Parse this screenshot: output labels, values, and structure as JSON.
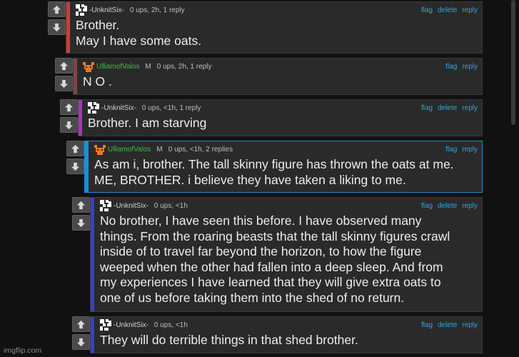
{
  "colors": {
    "background": "#111111",
    "panel": "#2a2a2a",
    "link": "#2aa7e0",
    "green_user": "#3fb950",
    "highlight_border": "#1a8fd6",
    "depth_stripes": [
      "#d33a3a",
      "#7a4a44",
      "#b22fc1",
      "#1a8fd6",
      "#3b3ccf",
      "#3b3ccf"
    ]
  },
  "icons": {
    "upvote": "up-arrow-icon",
    "downvote": "down-arrow-icon",
    "avatar_unknit": "pixel-avatar-icon",
    "avatar_ulliam": "orange-face-avatar-icon"
  },
  "comments": [
    {
      "username": "-UnknitSix-",
      "badge": "",
      "meta": "0 ups, 2h, 1 reply",
      "actions": [
        "flag",
        "delete",
        "reply"
      ],
      "text": "Brother.\nMay I have some oats."
    },
    {
      "username": "UlliamofValos",
      "badge": "M",
      "meta": "0 ups, 2h, 1 reply",
      "actions": [
        "flag",
        "reply"
      ],
      "text": "N O ."
    },
    {
      "username": "-UnknitSix-",
      "badge": "",
      "meta": "0 ups, <1h, 1 reply",
      "actions": [
        "flag",
        "delete",
        "reply"
      ],
      "text": "Brother. I am starving"
    },
    {
      "username": "UlliamofValos",
      "badge": "M",
      "meta": "0 ups, <1h, 2 replies",
      "actions": [
        "flag",
        "reply"
      ],
      "text": "As am i, brother. The tall skinny figure has thrown the oats at me.\nME, BROTHER. i believe they have taken a liking to me."
    },
    {
      "username": "-UnknitSix-",
      "badge": "",
      "meta": "0 ups, <1h",
      "actions": [
        "flag",
        "delete",
        "reply"
      ],
      "text": "No brother, I have seen this before. I have observed many\nthings. From the roaring beasts that the tall skinny figures crawl\ninside of to travel far beyond the horizon, to how the figure\nweeped when the other had fallen into a deep sleep. And from\nmy experiences I have learned that they will give extra oats to\none of us before taking them into the shed of no return."
    },
    {
      "username": "-UnknitSix-",
      "badge": "",
      "meta": "0 ups, <1h",
      "actions": [
        "flag",
        "delete",
        "reply"
      ],
      "text": "They will do terrible things in that shed brother."
    }
  ],
  "watermark": "imgflip.com"
}
